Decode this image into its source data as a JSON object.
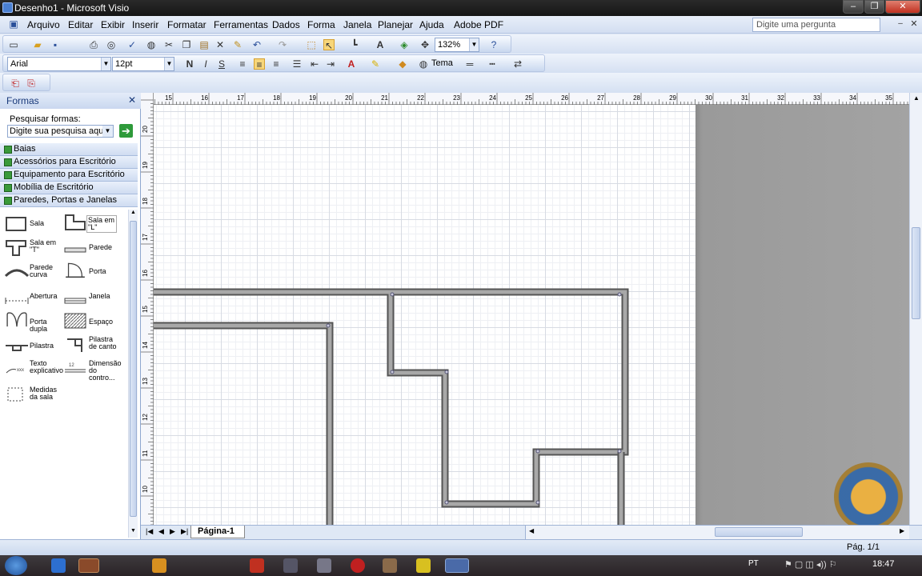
{
  "window": {
    "title": "Desenho1 - Microsoft Visio"
  },
  "menu": {
    "items": [
      "Arquivo",
      "Editar",
      "Exibir",
      "Inserir",
      "Formatar",
      "Ferramentas",
      "Dados",
      "Forma",
      "Janela",
      "Planejar",
      "Ajuda",
      "Adobe PDF"
    ],
    "ask_placeholder": "Digite uma pergunta"
  },
  "toolbar": {
    "zoom": "132%",
    "font": "Arial",
    "size": "12pt",
    "bold": "N",
    "italic": "I",
    "underline": "S",
    "theme": "Tema"
  },
  "shapes_panel": {
    "title": "Formas",
    "search_label": "Pesquisar formas:",
    "search_placeholder": "Digite sua pesquisa aqui",
    "stencils": [
      "Baias",
      "Acessórios para Escritório",
      "Equipamento para Escritório",
      "Mobília de Escritório",
      "Paredes, Portas e Janelas"
    ],
    "shapes": [
      {
        "label": "Sala"
      },
      {
        "label": "Sala em \"L\""
      },
      {
        "label": "Sala em \"T\""
      },
      {
        "label": "Parede"
      },
      {
        "label": "Parede curva"
      },
      {
        "label": "Porta"
      },
      {
        "label": "Abertura"
      },
      {
        "label": "Janela"
      },
      {
        "label": "Porta dupla"
      },
      {
        "label": "Espaço"
      },
      {
        "label": "Pilastra"
      },
      {
        "label": "Pilastra de canto"
      },
      {
        "label": "Texto explicativo"
      },
      {
        "label": "Dimensão do contro..."
      },
      {
        "label": "Medidas da sala"
      }
    ]
  },
  "ruler": {
    "h_labels": [
      "15",
      "16",
      "17",
      "18",
      "19",
      "20",
      "21",
      "22",
      "23",
      "24",
      "25",
      "26",
      "27",
      "28",
      "29",
      "30",
      "31",
      "32",
      "33",
      "34",
      "35"
    ],
    "v_labels": [
      "20",
      "19",
      "18",
      "17",
      "16",
      "15",
      "14",
      "13",
      "12",
      "11",
      "10"
    ]
  },
  "page_tab": "Página-1",
  "status": {
    "page": "Pág. 1/1"
  },
  "taskbar": {
    "lang": "PT",
    "time": "18:47"
  },
  "icons": [
    "visio-app-icon",
    "new-icon",
    "open-icon",
    "save-icon",
    "print-icon",
    "print-preview-icon",
    "spelling-icon",
    "cut-icon",
    "copy-icon",
    "paste-icon",
    "format-painter-icon",
    "undo-icon",
    "redo-icon",
    "shapes-icon",
    "pointer-icon",
    "connector-icon",
    "text-tool-icon",
    "stamp-icon",
    "pan-icon",
    "help-icon",
    "pdf-icon",
    "start-orb-icon",
    "ie-icon",
    "firefox-icon",
    "close-icon",
    "next-arrow-icon"
  ],
  "colors": {
    "accent": "#1a3a7a",
    "canvas": "#ffffff",
    "offpage": "#9a9a9a",
    "wall": "#8a8a8a"
  }
}
